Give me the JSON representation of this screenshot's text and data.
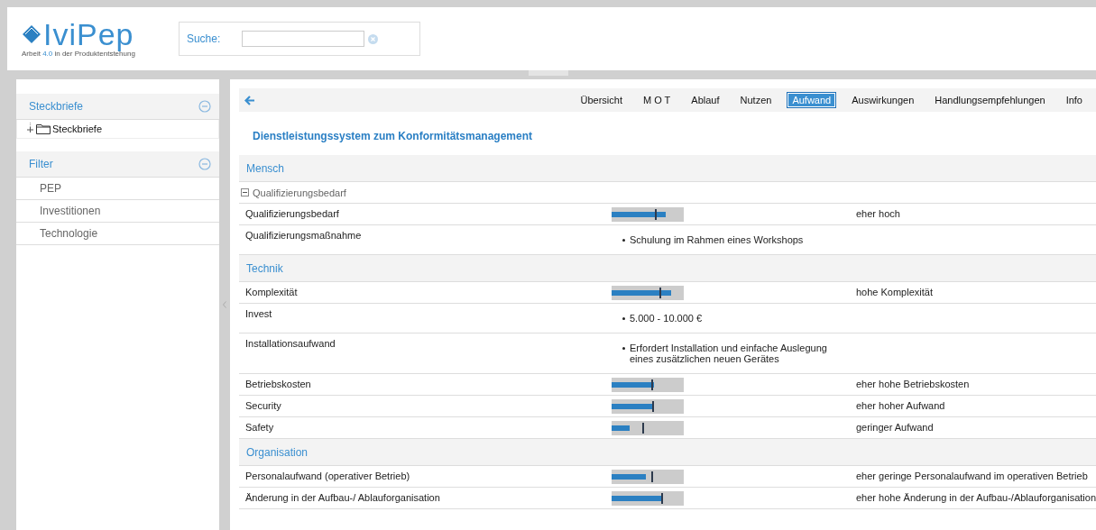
{
  "logo": {
    "name": "IviPep",
    "tagline_start": "Arbeit ",
    "tagline_highlight": "4.0",
    "tagline_end": " in der Produktentstehung"
  },
  "search": {
    "label": "Suche:"
  },
  "sidebar": {
    "panels": [
      {
        "title": "Steckbriefe",
        "expanded": true,
        "kind": "tree",
        "items": [
          {
            "label": "Steckbriefe",
            "expanded": false
          }
        ]
      },
      {
        "title": "Filter",
        "expanded": true,
        "kind": "list",
        "items": [
          {
            "label": "PEP"
          },
          {
            "label": "Investitionen"
          },
          {
            "label": "Technologie"
          }
        ]
      }
    ]
  },
  "nav": {
    "tabs": [
      {
        "label": "Übersicht",
        "selected": false
      },
      {
        "label": "M O T",
        "selected": false
      },
      {
        "label": "Ablauf",
        "selected": false
      },
      {
        "label": "Nutzen",
        "selected": false
      },
      {
        "label": "Aufwand",
        "selected": true
      },
      {
        "label": "Auswirkungen",
        "selected": false
      },
      {
        "label": "Handlungsempfehlungen",
        "selected": false
      },
      {
        "label": "Info",
        "selected": false
      }
    ]
  },
  "page_title": "Dienstleistungssystem zum  Konformitätsmanagement",
  "sections": [
    {
      "title": "Mensch",
      "group": {
        "title": "Qualifizierungsbedarf",
        "expanded": true
      },
      "rows": [
        {
          "kind": "bar",
          "label": "Qualifizierungsbedarf",
          "bar": {
            "level": 0.75
          },
          "marker": {
            "level": 0.61
          },
          "rating": "eher hoch"
        },
        {
          "kind": "list",
          "label": "Qualifizierungsmaßnahme",
          "items": [
            "Schulung im Rahmen eines Workshops"
          ]
        }
      ]
    },
    {
      "title": "Technik",
      "rows": [
        {
          "kind": "bar",
          "label": "Komplexität",
          "bar": {
            "level": 0.82
          },
          "marker": {
            "level": 0.68
          },
          "rating": "hohe Komplexität"
        },
        {
          "kind": "list",
          "label": "Invest",
          "items": [
            "5.000 - 10.000 €"
          ]
        },
        {
          "kind": "list",
          "label": "Installationsaufwand",
          "items": [
            "Erfordert Installation und einfache Auslegung eines zusätzlichen neuen Gerätes"
          ]
        },
        {
          "kind": "bar",
          "label": "Betriebskosten",
          "bar": {
            "level": 0.59
          },
          "marker": {
            "level": 0.56
          },
          "rating": "eher hohe Betriebskosten"
        },
        {
          "kind": "bar",
          "label": "Security",
          "bar": {
            "level": 0.57
          },
          "marker": {
            "level": 0.58
          },
          "rating": "eher hoher Aufwand"
        },
        {
          "kind": "bar",
          "label": "Safety",
          "bar": {
            "level": 0.25
          },
          "marker": {
            "level": 0.44
          },
          "rating": "geringer Aufwand"
        }
      ]
    },
    {
      "title": "Organisation",
      "rows": [
        {
          "kind": "bar",
          "label": "Personalaufwand (operativer Betrieb)",
          "bar": {
            "level": 0.48
          },
          "marker": {
            "level": 0.56
          },
          "rating": "eher geringe Personalaufwand im operativen Betrieb"
        },
        {
          "kind": "bar",
          "label": "Änderung in der Aufbau-/ Ablauforganisation",
          "bar": {
            "level": 0.7
          },
          "marker": {
            "level": 0.7
          },
          "rating": "eher hohe Änderung in der Aufbau-/Ablauforganisation"
        }
      ]
    }
  ]
}
